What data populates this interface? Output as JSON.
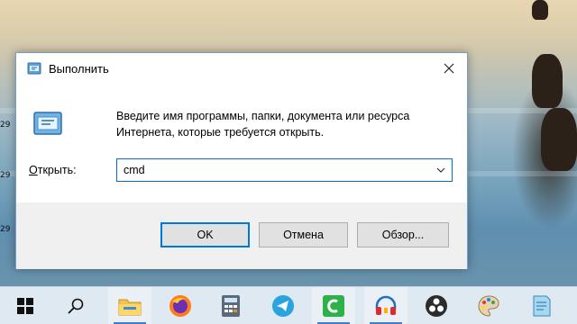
{
  "desktop": {
    "icon_labels": [
      "29",
      "29",
      "29"
    ]
  },
  "dialog": {
    "title": "Выполнить",
    "description_line1": "Введите имя программы, папки, документа или ресурса",
    "description_line2": "Интернета, которые требуется открыть.",
    "open_label_prefix": "О",
    "open_label_rest": "ткрыть:",
    "command_value": "cmd",
    "ok_label": "OK",
    "cancel_label": "Отмена",
    "browse_label": "Обзор..."
  },
  "taskbar": {
    "items": [
      {
        "name": "start",
        "icon": "windows-logo-icon"
      },
      {
        "name": "search",
        "icon": "search-icon"
      },
      {
        "name": "file-explorer",
        "icon": "folder-icon"
      },
      {
        "name": "firefox",
        "icon": "firefox-icon"
      },
      {
        "name": "calculator",
        "icon": "calculator-icon"
      },
      {
        "name": "telegram",
        "icon": "telegram-icon"
      },
      {
        "name": "camtasia",
        "icon": "camtasia-icon"
      },
      {
        "name": "audio-app",
        "icon": "headphones-icon"
      },
      {
        "name": "obs",
        "icon": "obs-icon"
      },
      {
        "name": "paint",
        "icon": "paint-palette-icon"
      },
      {
        "name": "notes",
        "icon": "notepad-icon"
      }
    ]
  },
  "colors": {
    "accent": "#0078d7",
    "taskbar_bg": "#dfe9f2",
    "dialog_footer": "#f0f0f0"
  }
}
